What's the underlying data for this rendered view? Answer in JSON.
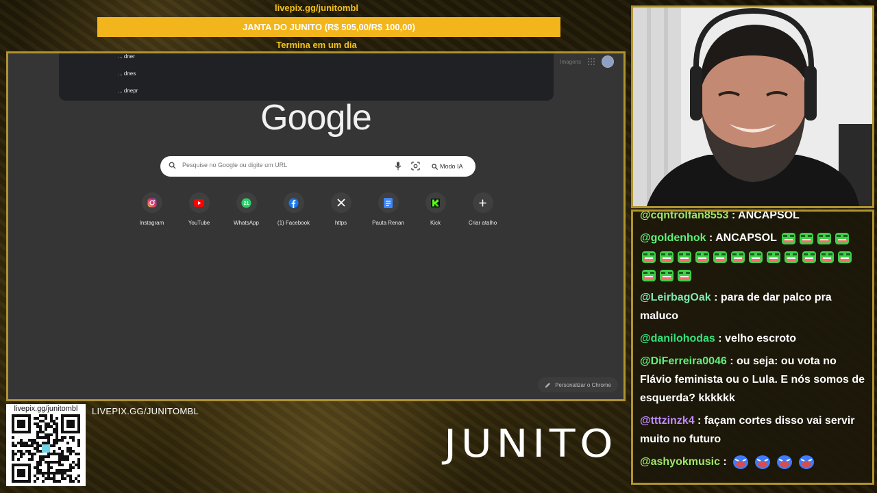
{
  "overlay": {
    "goal_url": "livepix.gg/junitombl",
    "goal_title": "JANTA DO JUNITO (R$ 505,00/R$ 100,00)",
    "goal_subtitle": "Termina em um dia",
    "qr_title": "livepix.gg/junitombl",
    "livepix_text": "LIVEPIX.GG/JUNITOMBL",
    "brand": "JUNITO",
    "accent_color": "#f3b51c",
    "frame_color": "#b09430"
  },
  "browser": {
    "suggestions": [
      "... dner",
      "... dnes",
      "... dnepr"
    ],
    "top_right": {
      "link": "Imagens",
      "apps_icon": "apps-grid-icon",
      "profile_icon": "profile-avatar"
    },
    "logo": "Google",
    "search": {
      "placeholder": "Pesquise no Google ou digite um URL",
      "ai_mode_label": "Modo IA"
    },
    "shortcuts": [
      {
        "label": "Instagram",
        "icon": "instagram-icon"
      },
      {
        "label": "YouTube",
        "icon": "youtube-icon"
      },
      {
        "label": "WhatsApp",
        "icon": "whatsapp-icon"
      },
      {
        "label": "(1) Facebook",
        "icon": "facebook-icon"
      },
      {
        "label": "https",
        "icon": "x-icon"
      },
      {
        "label": "Pauta Renan",
        "icon": "docs-icon"
      },
      {
        "label": "Kick",
        "icon": "kick-icon"
      },
      {
        "label": "Criar atalho",
        "icon": "plus-icon"
      }
    ],
    "customize_label": "Personalizar o Chrome"
  },
  "chat": {
    "messages": [
      {
        "user": "@cqntrolfan8553",
        "user_color": "#9ee86a",
        "text": "ANCAPSOL",
        "emotes": 0
      },
      {
        "user": "@goldenhok",
        "user_color": "#5ef27a",
        "text": "ANCAPSOL",
        "emotes": 19
      },
      {
        "user": "@LeirbagOak",
        "user_color": "#7fe8b0",
        "text": "para de dar palco pra maluco",
        "emotes": 0
      },
      {
        "user": "@danilohodas",
        "user_color": "#36e07a",
        "text": "velho escroto",
        "emotes": 0
      },
      {
        "user": "@DiFerreira0046",
        "user_color": "#5ef27a",
        "text": "ou seja: ou vota no Flávio feminista ou o Lula. E nós somos de esquerda? kkkkkk",
        "emotes": 0
      },
      {
        "user": "@tttzinzk4",
        "user_color": "#c08cff",
        "text": "façam cortes disso vai servir muito no futuro",
        "emotes": 0
      },
      {
        "user": "@ashyokmusic",
        "user_color": "#9ee86a",
        "text": "",
        "emotes": 4
      }
    ]
  }
}
